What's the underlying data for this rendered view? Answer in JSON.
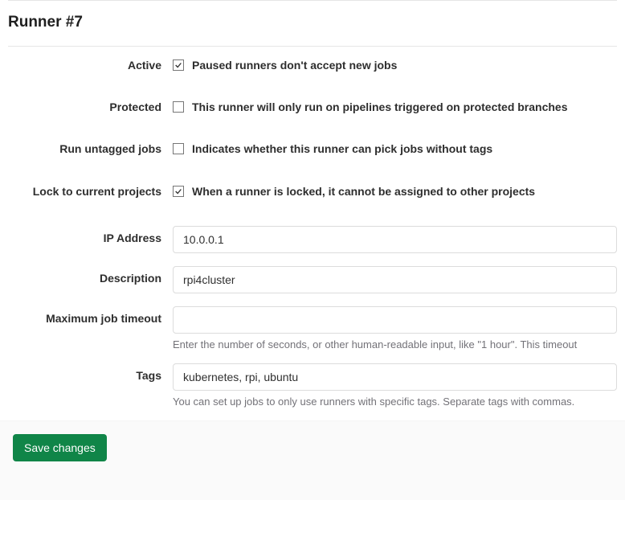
{
  "header": {
    "title": "Runner #7"
  },
  "form": {
    "active": {
      "label": "Active",
      "checked": true,
      "description": "Paused runners don't accept new jobs"
    },
    "protected": {
      "label": "Protected",
      "checked": false,
      "description": "This runner will only run on pipelines triggered on protected branches"
    },
    "run_untagged": {
      "label": "Run untagged jobs",
      "checked": false,
      "description": "Indicates whether this runner can pick jobs without tags"
    },
    "lock": {
      "label": "Lock to current projects",
      "checked": true,
      "description": "When a runner is locked, it cannot be assigned to other projects"
    },
    "ip": {
      "label": "IP Address",
      "value": "10.0.0.1"
    },
    "description": {
      "label": "Description",
      "value": "rpi4cluster"
    },
    "timeout": {
      "label": "Maximum job timeout",
      "value": "",
      "help": "Enter the number of seconds, or other human-readable input, like \"1 hour\". This timeout"
    },
    "tags": {
      "label": "Tags",
      "value": "kubernetes, rpi, ubuntu",
      "help": "You can set up jobs to only use runners with specific tags. Separate tags with commas."
    }
  },
  "actions": {
    "save": "Save changes"
  }
}
